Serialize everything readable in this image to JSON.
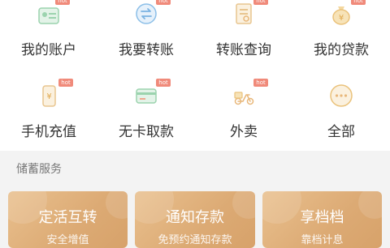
{
  "grid": {
    "items": [
      {
        "label": "我的账户",
        "icon": "account-card-icon",
        "badge": "hot"
      },
      {
        "label": "我要转账",
        "icon": "transfer-icon",
        "badge": "hot"
      },
      {
        "label": "转账查询",
        "icon": "transfer-query-icon",
        "badge": "hot"
      },
      {
        "label": "我的贷款",
        "icon": "loan-money-bag-icon",
        "badge": "hot"
      },
      {
        "label": "手机充值",
        "icon": "phone-recharge-icon",
        "badge": "hot"
      },
      {
        "label": "无卡取款",
        "icon": "cardless-withdraw-icon",
        "badge": "hot"
      },
      {
        "label": "外卖",
        "icon": "delivery-scooter-icon",
        "badge": "hot"
      },
      {
        "label": "全部",
        "icon": "more-dots-icon",
        "badge": ""
      }
    ]
  },
  "section": {
    "title": "储蓄服务"
  },
  "cards": [
    {
      "title": "定活互转",
      "subtitle": "安全增值"
    },
    {
      "title": "通知存款",
      "subtitle": "免预约通知存款"
    },
    {
      "title": "享档档",
      "subtitle": "靠档计息"
    }
  ],
  "colors": {
    "accent": "#e8b77a",
    "card": "#dcaa74",
    "badge": "#f08a7a"
  }
}
